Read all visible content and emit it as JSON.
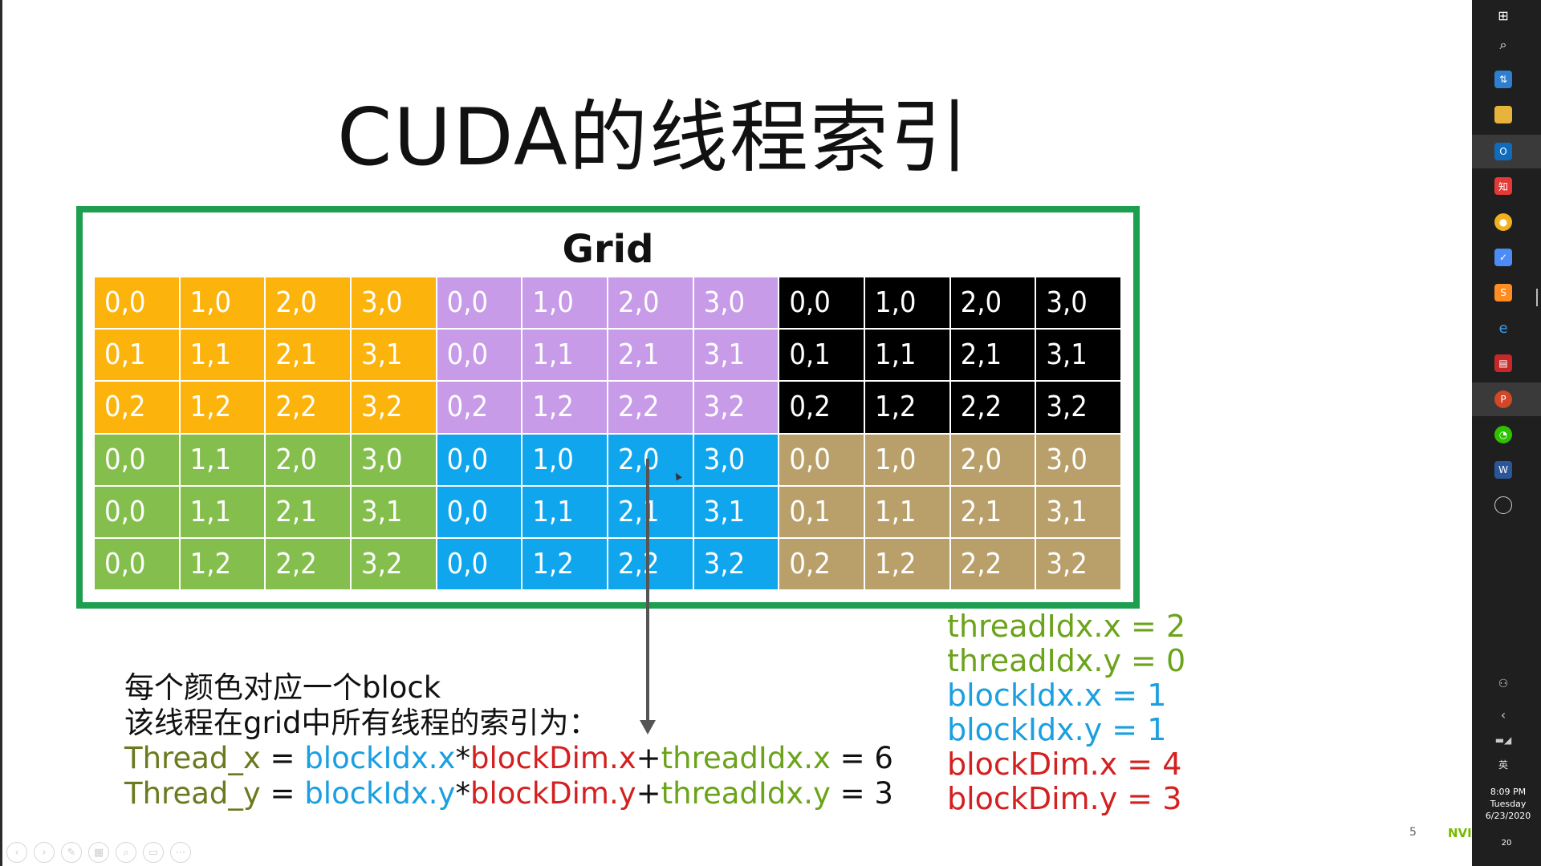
{
  "title": "CUDA的线程索引",
  "grid": {
    "label": "Grid",
    "colors": {
      "orange": "#FCB30B",
      "purple": "#C79BE8",
      "black": "#000000",
      "green": "#84BF4D",
      "blue": "#10A6EE",
      "tan": "#B9A06B"
    },
    "cells": [
      [
        "0,0",
        "1,0",
        "2,0",
        "3,0",
        "0,0",
        "1,0",
        "2,0",
        "3,0",
        "0,0",
        "1,0",
        "2,0",
        "3,0"
      ],
      [
        "0,1",
        "1,1",
        "2,1",
        "3,1",
        "0,0",
        "1,1",
        "2,1",
        "3,1",
        "0,1",
        "1,1",
        "2,1",
        "3,1"
      ],
      [
        "0,2",
        "1,2",
        "2,2",
        "3,2",
        "0,2",
        "1,2",
        "2,2",
        "3,2",
        "0,2",
        "1,2",
        "2,2",
        "3,2"
      ],
      [
        "0,0",
        "1,1",
        "2,0",
        "3,0",
        "0,0",
        "1,0",
        "2,0",
        "3,0",
        "0,0",
        "1,0",
        "2,0",
        "3,0"
      ],
      [
        "0,0",
        "1,1",
        "2,1",
        "3,1",
        "0,0",
        "1,1",
        "2,1",
        "3,1",
        "0,1",
        "1,1",
        "2,1",
        "3,1"
      ],
      [
        "0,0",
        "1,2",
        "2,2",
        "3,2",
        "0,0",
        "1,2",
        "2,2",
        "3,2",
        "0,2",
        "1,2",
        "2,2",
        "3,2"
      ]
    ]
  },
  "explanation": {
    "line1": "每个颜色对应一个block",
    "line2": "该线程在grid中所有线程的索引为：",
    "eq1": {
      "thread": "Thread_x",
      "eq": " = ",
      "bidx": "blockIdx.x",
      "star": "*",
      "bdim": "blockDim.x",
      "plus": "+",
      "tidx": "threadIdx.x",
      "result": " = 6"
    },
    "eq2": {
      "thread": "Thread_y",
      "eq": " = ",
      "bidx": "blockIdx.y",
      "star": "*",
      "bdim": "blockDim.y",
      "plus": "+",
      "tidx": "threadIdx.y",
      "result": " = 3"
    }
  },
  "values": [
    {
      "text": "threadIdx.x = 2",
      "color": "#6BA31A"
    },
    {
      "text": "threadIdx.y = 0",
      "color": "#6BA31A"
    },
    {
      "text": "blockIdx.x = 1",
      "color": "#1A9FE0"
    },
    {
      "text": "blockIdx.y = 1",
      "color": "#1A9FE0"
    },
    {
      "text": "blockDim.x = 4",
      "color": "#D32020"
    },
    {
      "text": "blockDim.y = 3",
      "color": "#D32020"
    }
  ],
  "text_colors": {
    "olive": "#6B7A1E",
    "blue": "#1A9FE0",
    "red": "#D32020",
    "green": "#6BA31A",
    "dark": "#111111"
  },
  "page_number": "5",
  "logo_text": "NVIDIA",
  "taskbar": {
    "time": "8:09 PM",
    "day": "Tuesday",
    "date": "6/23/2020",
    "ime": "英",
    "notif_count": "20",
    "icons": [
      "windows-icon",
      "search-icon",
      "network-icon",
      "file-explorer-icon",
      "outlook-icon",
      "app-red-icon",
      "chrome-icon",
      "feishu-icon",
      "sublime-icon",
      "ie-icon",
      "calendar-icon",
      "powerpoint-icon",
      "wechat-icon",
      "word-icon",
      "obs-icon"
    ]
  }
}
